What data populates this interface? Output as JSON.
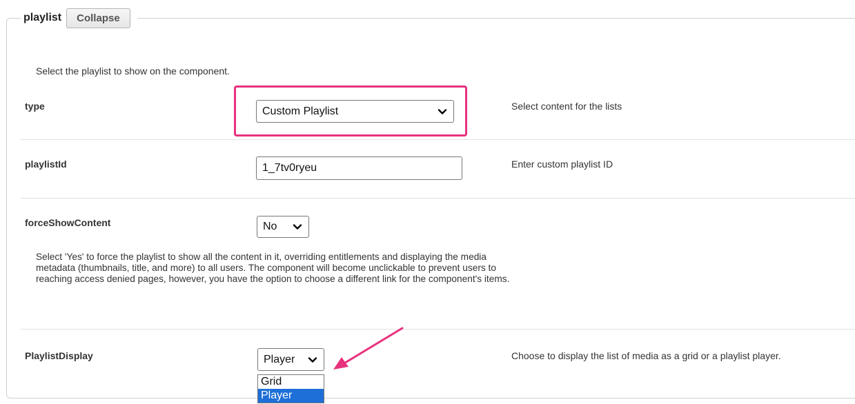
{
  "panel": {
    "legend_title": "playlist",
    "collapse_label": "Collapse",
    "intro": "Select the playlist to show on the component."
  },
  "rows": {
    "type": {
      "label": "type",
      "selected": "Custom Playlist",
      "description": "Select content for the lists"
    },
    "playlistId": {
      "label": "playlistId",
      "value": "1_7tv0ryeu",
      "description": "Enter custom playlist ID"
    },
    "forceShowContent": {
      "label": "forceShowContent",
      "selected": "No",
      "help": "Select 'Yes' to force the playlist to show all the content in it, overriding entitlements and displaying the media metadata (thumbnails, title, and more) to all users. The component will become unclickable to prevent users to reaching access denied pages, however, you have the option to choose a different link for the component's items."
    },
    "playlistDisplay": {
      "label": "PlaylistDisplay",
      "selected": "Player",
      "description": "Choose to display the list of media as a grid or a playlist player.",
      "options": [
        "Grid",
        "Player"
      ]
    }
  },
  "colors": {
    "highlight": "#e8317d",
    "option_selected": "#1e6fd8"
  }
}
